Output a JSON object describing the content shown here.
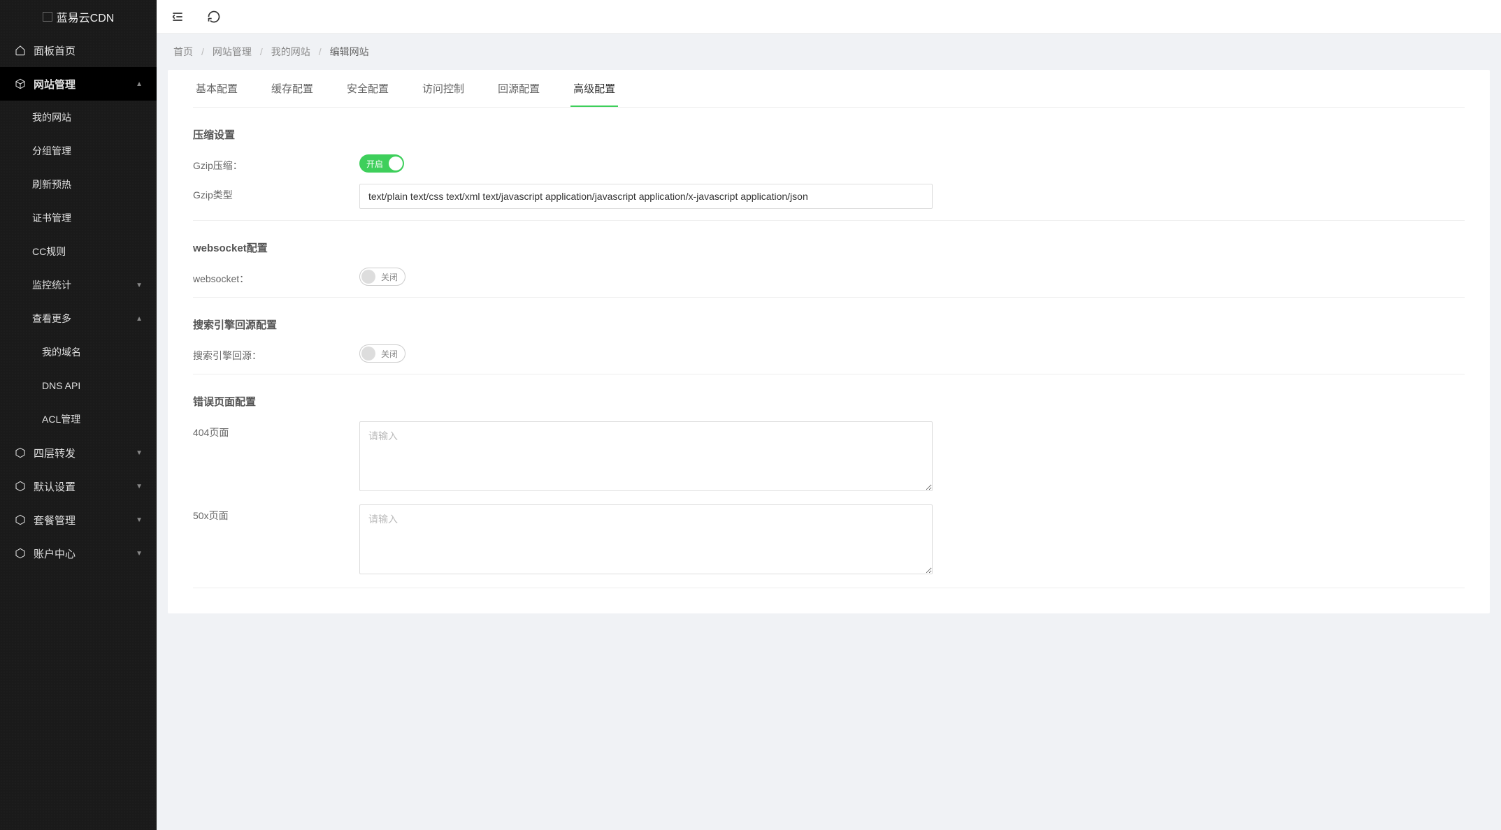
{
  "app_title": "蓝易云CDN",
  "sidebar": {
    "dashboard": "面板首页",
    "site_mgmt": "网站管理",
    "site_children": [
      "我的网站",
      "分组管理",
      "刷新预热",
      "证书管理",
      "CC规则"
    ],
    "monitor": "监控统计",
    "view_more": "查看更多",
    "view_more_children": [
      "我的域名",
      "DNS API",
      "ACL管理"
    ],
    "layer4": "四层转发",
    "default_settings": "默认设置",
    "package_mgmt": "套餐管理",
    "account": "账户中心"
  },
  "breadcrumb": [
    "首页",
    "网站管理",
    "我的网站",
    "编辑网站"
  ],
  "tabs": [
    "基本配置",
    "缓存配置",
    "安全配置",
    "访问控制",
    "回源配置",
    "高级配置"
  ],
  "active_tab_index": 5,
  "sections": {
    "compress": {
      "title": "压缩设置",
      "gzip_label": "Gzip压缩：",
      "gzip_on_text": "开启",
      "gzip_type_label": "Gzip类型",
      "gzip_type_value": "text/plain text/css text/xml text/javascript application/javascript application/x-javascript application/json"
    },
    "websocket": {
      "title": "websocket配置",
      "label": "websocket：",
      "off_text": "关闭"
    },
    "search_origin": {
      "title": "搜索引擎回源配置",
      "label": "搜索引擎回源：",
      "off_text": "关闭"
    },
    "error_page": {
      "title": "错误页面配置",
      "p404_label": "404页面",
      "p50x_label": "50x页面",
      "placeholder": "请输入"
    }
  }
}
